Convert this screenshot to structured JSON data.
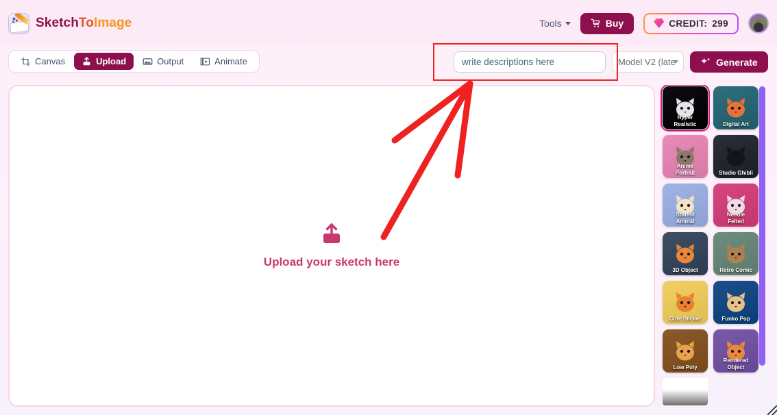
{
  "app": {
    "brand_part1": "Sketch",
    "brand_part2": "To",
    "brand_part3": "Image",
    "logo_icon": "sketch-app-icon"
  },
  "header": {
    "tools_label": "Tools",
    "buy_label": "Buy",
    "buy_icon": "shopping-cart-icon",
    "credit_label": "CREDIT:",
    "credit_value": "299",
    "credit_icon": "gem-icon",
    "avatar_icon": "user-avatar",
    "caret_icon": "chevron-down-icon"
  },
  "tabs": [
    {
      "label": "Canvas",
      "icon": "crop-frame-icon",
      "active": false
    },
    {
      "label": "Upload",
      "icon": "upload-tray-icon",
      "active": true
    },
    {
      "label": "Output",
      "icon": "image-icon",
      "active": false
    },
    {
      "label": "Animate",
      "icon": "film-frames-icon",
      "active": false
    }
  ],
  "prompt": {
    "placeholder": "write descriptions here",
    "value": "",
    "model_value": "Model V2 (late",
    "generate_label": "Generate",
    "generate_icon": "sparkles-icon"
  },
  "canvas": {
    "upload_text": "Upload your sketch here",
    "upload_icon": "upload-arrow-icon"
  },
  "annotation": {
    "highlight_color": "#ef2222",
    "arrow_color": "#ef2222",
    "shape": "red-arrow-pointing-to-prompt-input"
  },
  "styles": [
    {
      "label": "Hyper\nRealistic",
      "selected": true,
      "bg": "#0d0d12",
      "accent": "#e6e4e8"
    },
    {
      "label": "Digital Art",
      "selected": false,
      "bg": "#2f6e7a",
      "accent": "#e8703a"
    },
    {
      "label": "Anime\nPortrait",
      "selected": false,
      "bg": "#e88bb8",
      "accent": "#8b7668"
    },
    {
      "label": "Studio Ghibli",
      "selected": false,
      "bg": "#2b3038",
      "accent": "#121418"
    },
    {
      "label": "Stuffed\nAnimal",
      "selected": false,
      "bg": "#9fb3e5",
      "accent": "#f3e2c8"
    },
    {
      "label": "Needle\nFelted",
      "selected": false,
      "bg": "#d7477f",
      "accent": "#f0dbe4"
    },
    {
      "label": "3D Object",
      "selected": false,
      "bg": "#3e4e63",
      "accent": "#e8873c"
    },
    {
      "label": "Retro Comic",
      "selected": false,
      "bg": "#6f8d7f",
      "accent": "#b08050"
    },
    {
      "label": "Cute Sticker",
      "selected": false,
      "bg": "#f2cf63",
      "accent": "#e8802c"
    },
    {
      "label": "Funko Pop",
      "selected": false,
      "bg": "#1c4f88",
      "accent": "#e8c08a"
    },
    {
      "label": "Low Poly",
      "selected": false,
      "bg": "#8a5a2b",
      "accent": "#eaa24f"
    },
    {
      "label": "Rendered\nObject",
      "selected": false,
      "bg": "#7a5aa8",
      "accent": "#e8883c"
    },
    {
      "label": "",
      "selected": false,
      "bg": "#ffffff",
      "accent": "#9a9a9a"
    }
  ],
  "scrollbar": {
    "color": "#9160f5"
  }
}
